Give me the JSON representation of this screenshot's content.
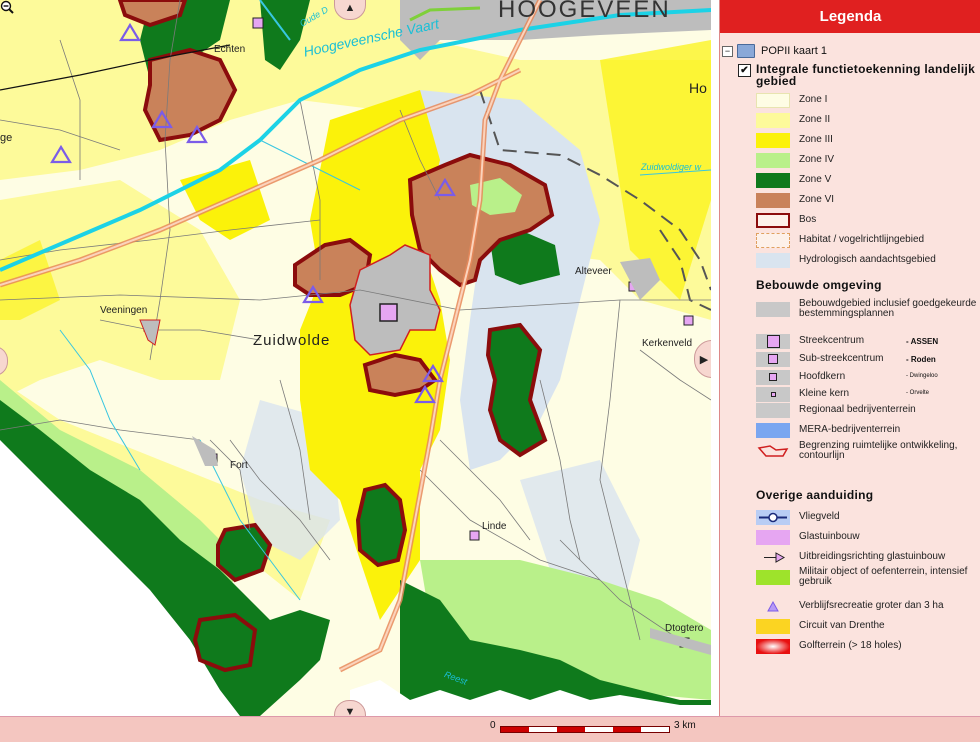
{
  "map": {
    "places": {
      "hoogeveen": "HOOGEVEEN",
      "echten": "Echten",
      "zuidwolde": "Zuidwolde",
      "veeningen": "Veeningen",
      "fort": "Fort",
      "linde": "Linde",
      "alteveer": "Alteveer",
      "kerkenveld": "Kerkenveld",
      "dtogteropslagen": "Dtogtero",
      "ho": "Ho",
      "ge": "ge"
    },
    "water": {
      "hoogeveensche_vaart": "Hoogeveensche Vaart",
      "oude_diep": "Oude D",
      "zuidwoldiger": "Zuidwoldiger w",
      "reest": "Reest"
    },
    "colors": {
      "zone1": "#fefde4",
      "zone2": "#fdfa9a",
      "zone3": "#fbf20a",
      "zone4": "#b9f08a",
      "zone5": "#0f7a1c",
      "zone6": "#c9825a",
      "bos_border": "#8b0c0c",
      "hydro": "#d9e4ef",
      "built": "#bdbdbd",
      "canal": "#1cd2e6",
      "road": "#f0a77e"
    }
  },
  "nav": {
    "up": "▲",
    "down": "▼",
    "right": "▶"
  },
  "scale": {
    "start": "0",
    "end": "3 km"
  },
  "legend": {
    "title": "Legenda",
    "tree_root": "POPII kaart 1",
    "collapse": "−",
    "check": "✔",
    "group1_title": "Integrale functietoekenning landelijk gebied",
    "group1_items": [
      {
        "label": "Zone I",
        "color": "#fefde4"
      },
      {
        "label": "Zone II",
        "color": "#fdfa9a"
      },
      {
        "label": "Zone III",
        "color": "#fbf20a"
      },
      {
        "label": "Zone IV",
        "color": "#b9f08a"
      },
      {
        "label": "Zone V",
        "color": "#0f7a1c"
      },
      {
        "label": "Zone VI",
        "color": "#c9825a"
      },
      {
        "label": "Bos"
      },
      {
        "label": "Habitat / vogelrichtlijngebied"
      },
      {
        "label": "Hydrologisch aandachtsgebied",
        "color": "#d9e4ef"
      }
    ],
    "group2_title": "Bebouwde omgeving",
    "group2_items": [
      {
        "label": "Bebouwdgebied inclusief goedgekeurde bestemmingsplannen"
      },
      {
        "label": "Streekcentrum",
        "extra": "- ASSEN"
      },
      {
        "label": "Sub-streekcentrum",
        "extra": "- Roden"
      },
      {
        "label": "Hoofdkern",
        "extra": "- Dwingeloo"
      },
      {
        "label": "Kleine kern",
        "extra": "- Orvelte"
      },
      {
        "label": "Regionaal bedrijventerrein"
      },
      {
        "label": "MERA-bedrijventerrein"
      },
      {
        "label": "Begrenzing ruimtelijke ontwikkeling, contourlijn"
      }
    ],
    "group3_title": "Overige aanduiding",
    "group3_items": [
      {
        "label": "Vliegveld"
      },
      {
        "label": "Glastuinbouw"
      },
      {
        "label": "Uitbreidingsrichting glastuinbouw"
      },
      {
        "label": "Militair object of oefenterrein, intensief gebruik"
      },
      {
        "label": "Verblijfsrecreatie groter dan 3 ha"
      },
      {
        "label": "Circuit van Drenthe"
      },
      {
        "label": "Golfterrein (> 18 holes)"
      }
    ]
  }
}
